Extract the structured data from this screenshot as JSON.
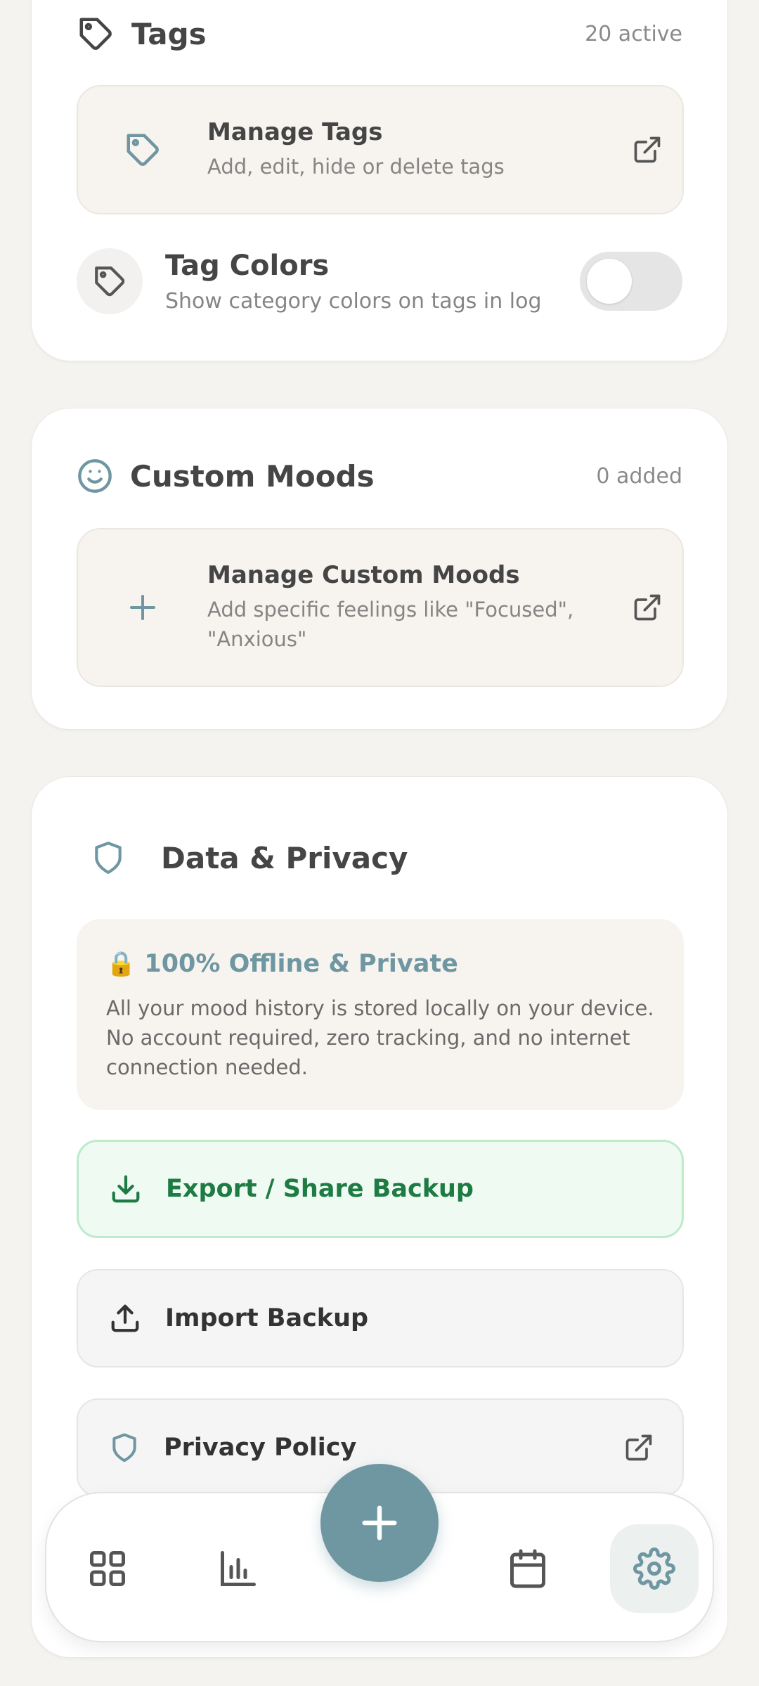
{
  "tags_section": {
    "title": "Tags",
    "meta": "20 active",
    "manage": {
      "title": "Manage Tags",
      "subtitle": "Add, edit, hide or delete tags"
    },
    "colors": {
      "title": "Tag Colors",
      "subtitle": "Show category colors on tags in log",
      "enabled": false
    }
  },
  "moods_section": {
    "title": "Custom Moods",
    "meta": "0 added",
    "manage": {
      "title": "Manage Custom Moods",
      "subtitle_line1": "Add specific feelings like \"Focused\",",
      "subtitle_line2": "\"Anxious\""
    }
  },
  "privacy_section": {
    "title": "Data & Privacy",
    "note": {
      "icon": "🔒",
      "title": "100% Offline & Private",
      "line1": "All your mood history is stored locally on your device.",
      "line2": "No account required, zero tracking, and no internet",
      "line3": "connection needed."
    },
    "export_label": "Export / Share Backup",
    "import_label": "Import Backup",
    "policy_label": "Privacy Policy"
  },
  "nav": {
    "items": [
      "dashboard-icon",
      "stats-icon",
      "add-icon",
      "calendar-icon",
      "settings-icon"
    ],
    "active": "settings"
  },
  "colors": {
    "accent": "#6f97a2",
    "export_green": "#1d7b43",
    "background": "#f5f3ef"
  }
}
